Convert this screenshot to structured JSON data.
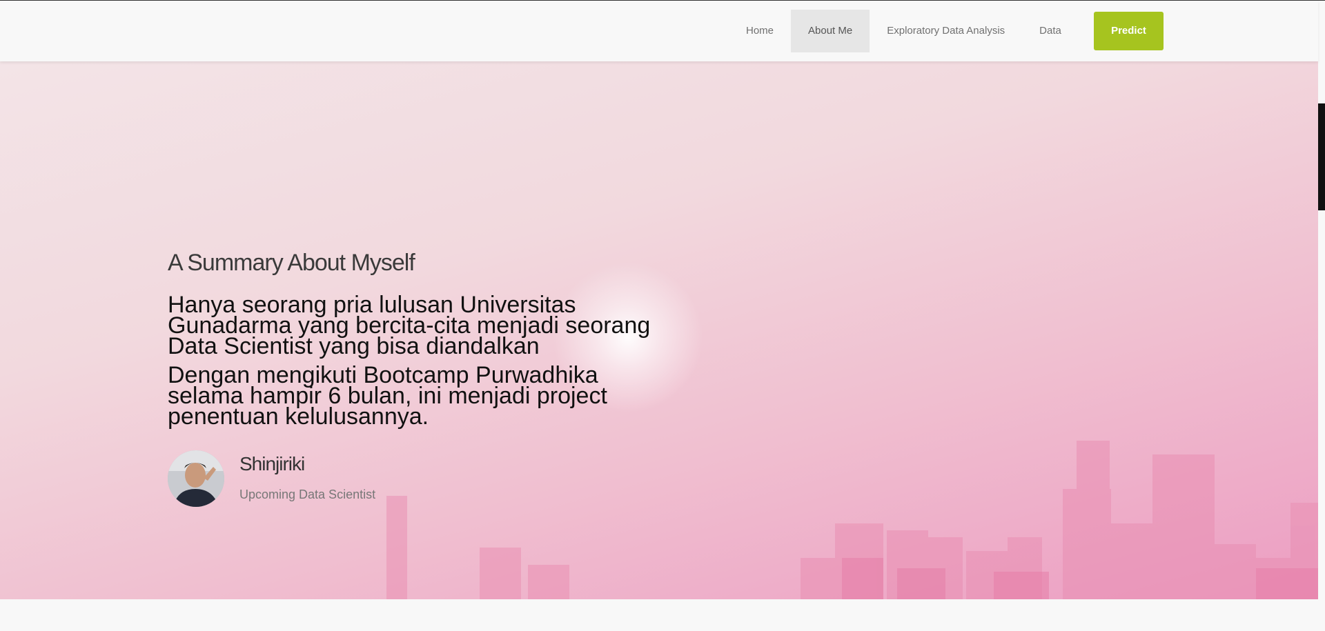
{
  "nav": {
    "items": [
      {
        "label": "Home",
        "active": false
      },
      {
        "label": "About Me",
        "active": true
      },
      {
        "label": "Exploratory Data Analysis",
        "active": false
      },
      {
        "label": "Data",
        "active": false
      }
    ],
    "predict_label": "Predict"
  },
  "about": {
    "title": "A Summary About Myself",
    "paragraphs": [
      "Hanya seorang pria lulusan Universitas Gunadarma yang bercita-cita menjadi seorang Data Scientist yang bisa diandalkan",
      "Dengan mengikuti Bootcamp Purwadhika selama hampir 6 bulan, ini menjadi project penentuan kelulusannya."
    ]
  },
  "profile": {
    "name": "Shinjiriki",
    "role": "Upcoming Data Scientist"
  },
  "colors": {
    "accent": "#a6c41f",
    "hero_pink": "#ec9dc2",
    "nav_bg": "#f8f8f8"
  }
}
